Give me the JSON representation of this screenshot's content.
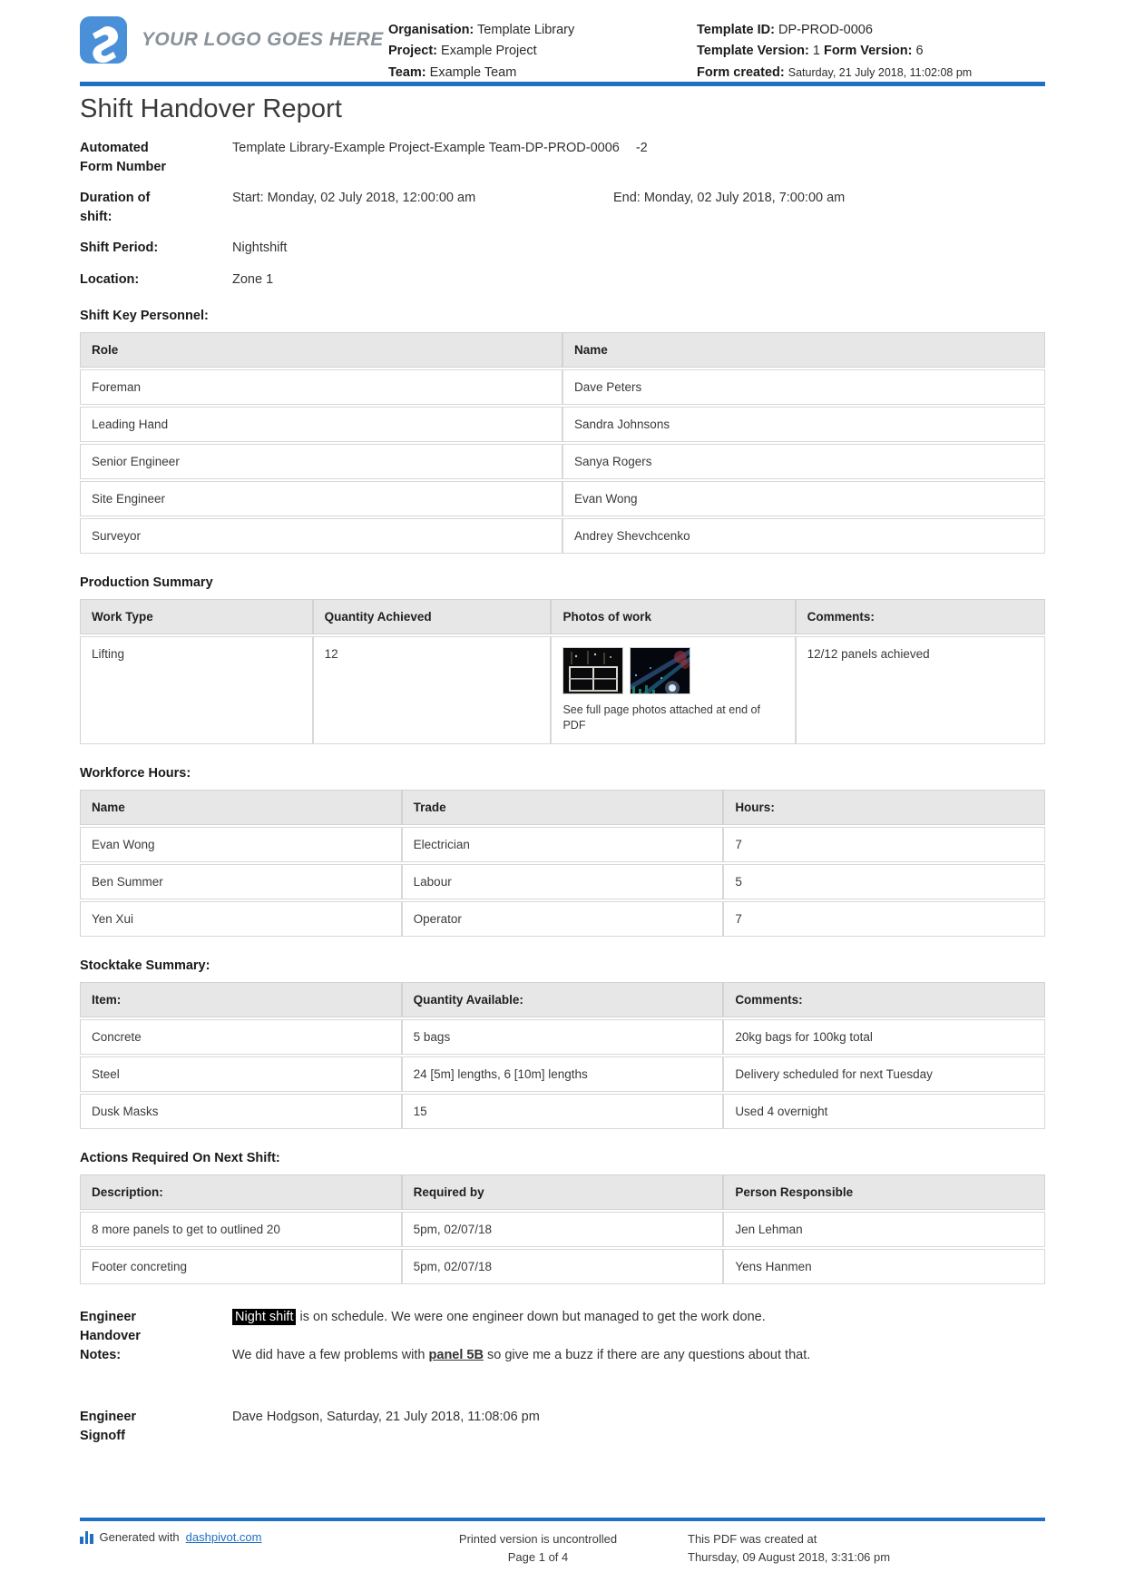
{
  "header": {
    "logo_text": "YOUR LOGO GOES HERE",
    "organisation_label": "Organisation:",
    "organisation_value": "Template Library",
    "project_label": "Project:",
    "project_value": "Example Project",
    "team_label": "Team:",
    "team_value": "Example Team",
    "template_id_label": "Template ID:",
    "template_id_value": "DP-PROD-0006",
    "template_version_label": "Template Version:",
    "template_version_value": "1",
    "form_version_label": "Form Version:",
    "form_version_value": "6",
    "form_created_label": "Form created:",
    "form_created_value": "Saturday, 21 July 2018, 11:02:08 pm",
    "accent_color": "#1f6fc4"
  },
  "title": "Shift Handover Report",
  "fields": {
    "form_number_label_1": "Automated",
    "form_number_label_2": "Form Number",
    "form_number_value": "Template Library-Example Project-Example Team-DP-PROD-0006",
    "form_number_suffix": "-2",
    "duration_label_1": "Duration of",
    "duration_label_2": "shift:",
    "duration_start": "Start: Monday, 02 July 2018, 12:00:00 am",
    "duration_end": "End: Monday, 02 July 2018, 7:00:00 am",
    "shift_period_label": "Shift Period:",
    "shift_period_value": "Nightshift",
    "location_label": "Location:",
    "location_value": "Zone 1"
  },
  "personnel": {
    "title": "Shift Key Personnel:",
    "columns": [
      "Role",
      "Name"
    ],
    "rows": [
      [
        "Foreman",
        "Dave Peters"
      ],
      [
        "Leading Hand",
        "Sandra Johnsons"
      ],
      [
        "Senior Engineer",
        "Sanya Rogers"
      ],
      [
        "Site Engineer",
        "Evan Wong"
      ],
      [
        "Surveyor",
        "Andrey Shevchcenko"
      ]
    ]
  },
  "production": {
    "title": "Production Summary",
    "columns": [
      "Work Type",
      "Quantity Achieved",
      "Photos of work",
      "Comments:"
    ],
    "work_type": "Lifting",
    "quantity": "12",
    "photo_note": "See full page photos attached at end of PDF",
    "comments": "12/12 panels achieved"
  },
  "workforce": {
    "title": "Workforce Hours:",
    "columns": [
      "Name",
      "Trade",
      "Hours:"
    ],
    "rows": [
      [
        "Evan Wong",
        "Electrician",
        "7"
      ],
      [
        "Ben Summer",
        "Labour",
        "5"
      ],
      [
        "Yen Xui",
        "Operator",
        "7"
      ]
    ]
  },
  "stocktake": {
    "title": "Stocktake Summary:",
    "columns": [
      "Item:",
      "Quantity Available:",
      "Comments:"
    ],
    "rows": [
      [
        "Concrete",
        "5 bags",
        "20kg bags for 100kg total"
      ],
      [
        "Steel",
        "24 [5m] lengths, 6 [10m] lengths",
        "Delivery scheduled for next Tuesday"
      ],
      [
        "Dusk Masks",
        "15",
        "Used 4 overnight"
      ]
    ]
  },
  "actions": {
    "title": "Actions Required On Next Shift:",
    "columns": [
      "Description:",
      "Required by",
      "Person Responsible"
    ],
    "rows": [
      [
        "8 more panels to get to outlined 20",
        "5pm, 02/07/18",
        "Jen Lehman"
      ],
      [
        "Footer concreting",
        "5pm, 02/07/18",
        "Yens Hanmen"
      ]
    ]
  },
  "notes": {
    "label_1": "Engineer",
    "label_2": "Handover",
    "label_3": "Notes:",
    "para1_highlight": "Night shift",
    "para1_rest": " is on schedule. We were one engineer down but managed to get the work done.",
    "para2_before": "We did have a few problems with ",
    "para2_underline": "panel 5B",
    "para2_after": " so give me a buzz if there are any questions about that."
  },
  "signoff": {
    "label_1": "Engineer",
    "label_2": "Signoff",
    "value": "Dave Hodgson, Saturday, 21 July 2018, 11:08:06 pm"
  },
  "footer": {
    "generated_prefix": "Generated with ",
    "generated_link": "dashpivot.com",
    "uncontrolled": "Printed version is uncontrolled",
    "page": "Page 1 of 4",
    "created_at_label": "This PDF was created at",
    "created_at_value": "Thursday, 09 August 2018, 3:31:06 pm"
  }
}
